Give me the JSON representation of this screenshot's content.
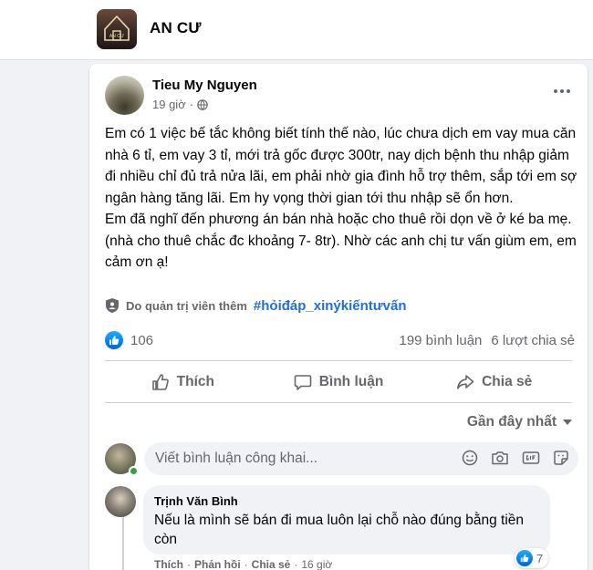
{
  "group": {
    "name": "AN CƯ",
    "logo_text": "AN CƯ"
  },
  "post": {
    "author": "Tieu My Nguyen",
    "time": "19 giờ",
    "separator": "·",
    "paragraph_1": "Em có 1 việc bế tắc không biết tính thế nào, lúc chưa dịch em vay mua căn nhà 6 tỉ, em vay 3 tỉ, mới trả gốc được 300tr, nay dịch bệnh thu nhập giảm đi nhiều chỉ đủ trả nửa lãi, em phải nhờ gia đình hỗ trợ thêm, sắp tới em sợ ngân hàng tăng lãi. Em hy vọng thời gian tới thu nhập sẽ ổn hơn.",
    "paragraph_2": "Em đã nghĩ đến phương án bán nhà hoặc cho thuê rồi dọn về ở ké ba mẹ.(nhà cho thuê chắc đc khoảng 7- 8tr). Nhờ các anh chị tư vấn giùm em, em cảm ơn ạ!",
    "admin_label": "Do quản trị viên thêm",
    "hashtag": "#hỏiđáp_xinýkiếntưvấn",
    "like_count": "106",
    "comment_count": "199 bình luận",
    "share_count": "6 lượt chia sẻ"
  },
  "actions": {
    "like": "Thích",
    "comment": "Bình luận",
    "share": "Chia sẻ"
  },
  "sort": {
    "label": "Gần đây nhất"
  },
  "composer": {
    "placeholder": "Viết bình luận công khai..."
  },
  "comment": {
    "author": "Trịnh Văn Bình",
    "text": "Nếu là mình sẽ bán đi mua luôn lại chỗ nào đúng bằng tiền còn",
    "reaction_count": "7",
    "like": "Thích",
    "reply": "Phản hồi",
    "share": "Chia sẻ",
    "time": "16 giờ",
    "dot": "·"
  },
  "colors": {
    "accent": "#216fdb",
    "like_blue": "#0571ed",
    "online": "#31a24c",
    "secondary_text": "#65676b"
  }
}
